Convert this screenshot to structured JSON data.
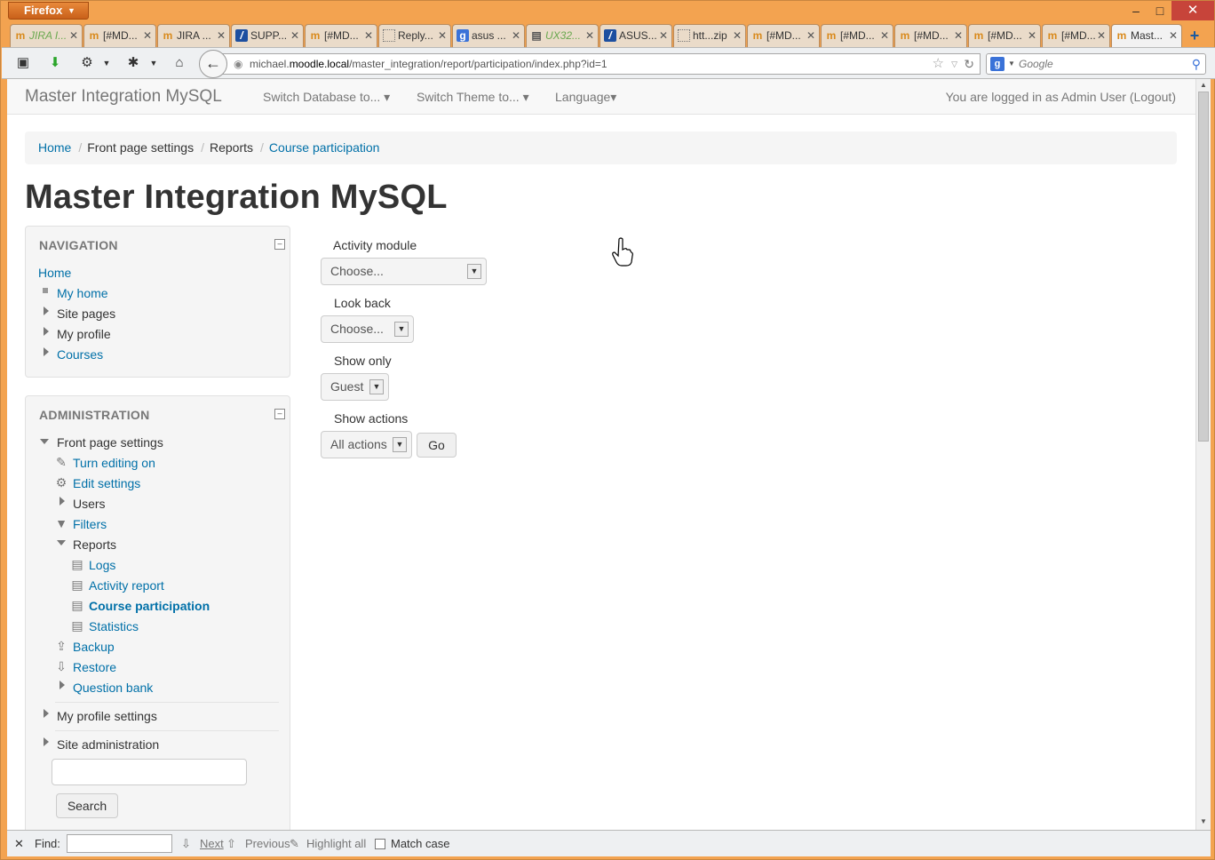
{
  "browser": {
    "menu_label": "Firefox",
    "tabs": [
      {
        "label": "JIRA I...",
        "icon": "moodle-icon"
      },
      {
        "label": "[#MD...",
        "icon": "moodle-icon"
      },
      {
        "label": "JIRA ...",
        "icon": "moodle-icon"
      },
      {
        "label": "SUPP...",
        "icon": "jira-icon"
      },
      {
        "label": "[#MD...",
        "icon": "moodle-icon"
      },
      {
        "label": "Reply...",
        "icon": "blank-page-icon"
      },
      {
        "label": "asus ...",
        "icon": "google-icon"
      },
      {
        "label": "UX32...",
        "icon": "page-icon"
      },
      {
        "label": "ASUS...",
        "icon": "jira-icon"
      },
      {
        "label": "htt...zip",
        "icon": "blank-page-icon"
      },
      {
        "label": "[#MD...",
        "icon": "moodle-icon"
      },
      {
        "label": "[#MD...",
        "icon": "moodle-icon"
      },
      {
        "label": "[#MD...",
        "icon": "moodle-icon"
      },
      {
        "label": "[#MD...",
        "icon": "moodle-icon"
      },
      {
        "label": "[#MD...",
        "icon": "moodle-icon"
      },
      {
        "label": "Mast...",
        "icon": "moodle-icon",
        "active": true
      }
    ],
    "url_host_prefix": "michael.",
    "url_host_domain": "moodle.local",
    "url_path": "/master_integration/report/participation/index.php?id=1",
    "search_placeholder": "Google"
  },
  "site": {
    "brand": "Master Integration MySQL",
    "menu": [
      "Switch Database to...",
      "Switch Theme to...",
      "Language"
    ],
    "login_info": "You are logged in as Admin User (Logout)"
  },
  "breadcrumb": [
    "Home",
    "Front page settings",
    "Reports",
    "Course participation"
  ],
  "page_title": "Master Integration MySQL",
  "navigation": {
    "title": "NAVIGATION",
    "home": "Home",
    "items": [
      "My home",
      "Site pages",
      "My profile",
      "Courses"
    ]
  },
  "administration": {
    "title": "ADMINISTRATION",
    "front_page_settings": "Front page settings",
    "items": [
      "Turn editing on",
      "Edit settings",
      "Users",
      "Filters",
      "Reports"
    ],
    "reports": [
      "Logs",
      "Activity report",
      "Course participation",
      "Statistics"
    ],
    "more": [
      "Backup",
      "Restore",
      "Question bank"
    ],
    "my_profile_settings": "My profile settings",
    "site_administration": "Site administration",
    "search_button": "Search"
  },
  "form": {
    "activity_module_label": "Activity module",
    "activity_module_value": "Choose...",
    "look_back_label": "Look back",
    "look_back_value": "Choose...",
    "show_only_label": "Show only",
    "show_only_value": "Guest",
    "show_actions_label": "Show actions",
    "show_actions_value": "All actions",
    "go_button": "Go"
  },
  "findbar": {
    "label": "Find:",
    "next": "Next",
    "previous": "Previous",
    "highlight": "Highlight all",
    "match_case": "Match case"
  }
}
